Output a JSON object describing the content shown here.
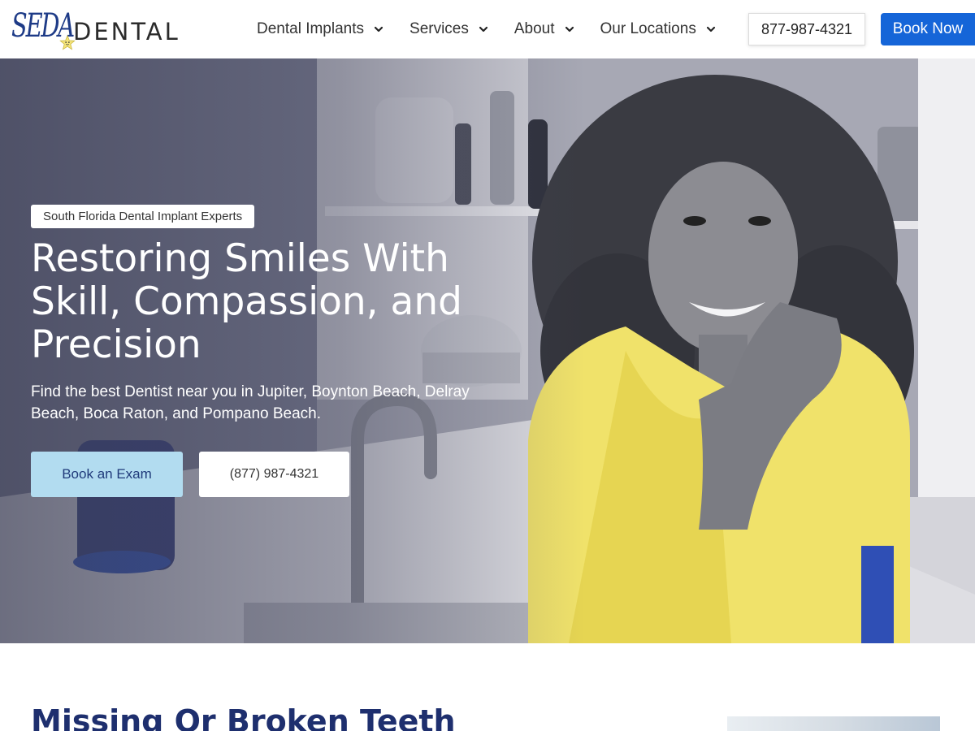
{
  "brand": {
    "logo_text_1": "SEDA",
    "logo_text_2": "DENTAL",
    "accent_color": "#1565d8",
    "navy_color": "#1e3b87"
  },
  "nav": {
    "items": [
      {
        "label": "Dental Implants"
      },
      {
        "label": "Services"
      },
      {
        "label": "About"
      },
      {
        "label": "Our Locations"
      }
    ],
    "phone": "877-987-4321",
    "cta": "Book Now"
  },
  "hero": {
    "eyebrow": "South Florida Dental Implant Experts",
    "title_lines": [
      "Restoring Smiles With",
      "Skill, Compassion, and",
      "Precision"
    ],
    "subtitle": "Find the best Dentist near you in Jupiter, Boynton Beach, Delray Beach, Boca Raton, and Pompano Beach.",
    "primary_button": "Book an Exam",
    "secondary_button": "(877) 987-4321",
    "primary_button_color": "#b2dcf0"
  },
  "section": {
    "title": "Missing Or Broken Teeth"
  }
}
